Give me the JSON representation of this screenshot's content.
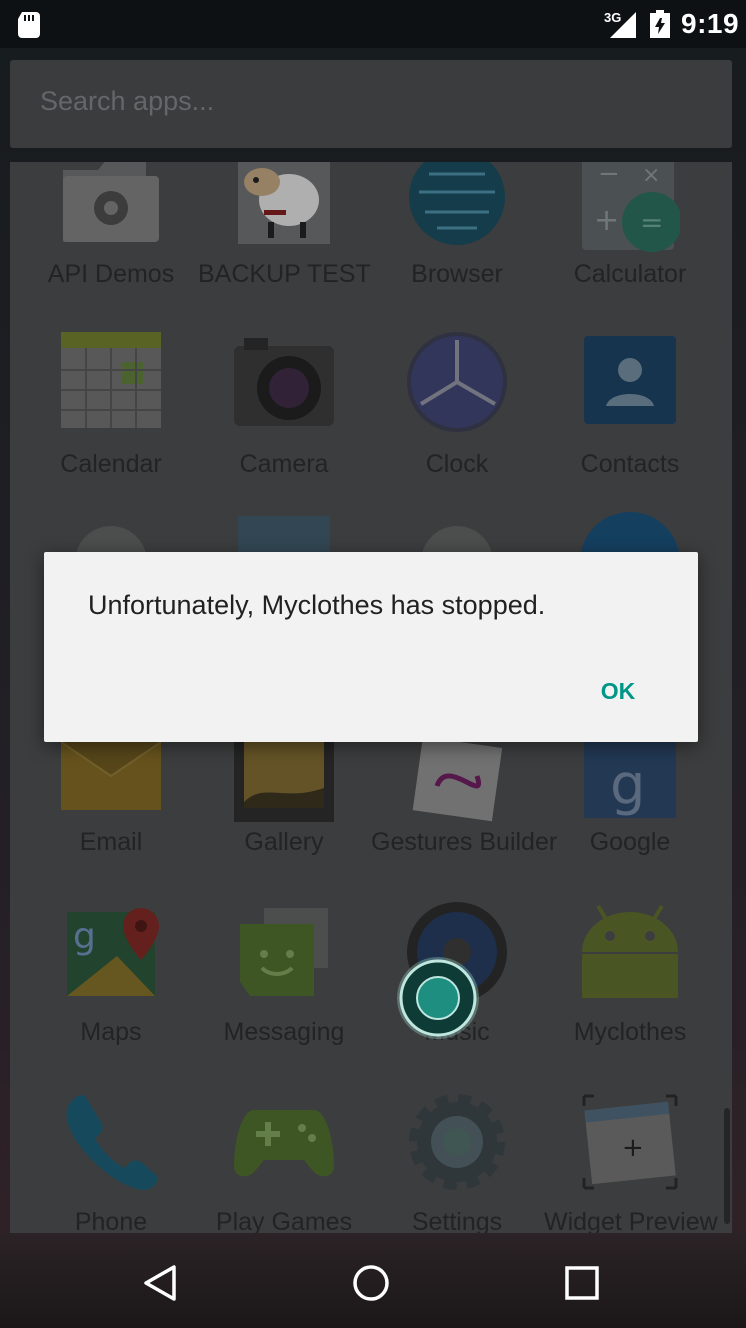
{
  "status_bar": {
    "network": "3G",
    "time": "9:19",
    "icons": [
      "sd-card-icon",
      "signal-icon",
      "battery-icon"
    ]
  },
  "search": {
    "placeholder": "Search apps..."
  },
  "apps": [
    {
      "label": "API Demos",
      "icon": "folder-gear-icon"
    },
    {
      "label": "BACKUP TEST",
      "icon": "sheep-icon"
    },
    {
      "label": "Browser",
      "icon": "globe-icon"
    },
    {
      "label": "Calculator",
      "icon": "calculator-icon"
    },
    {
      "label": "Calendar",
      "icon": "calendar-icon"
    },
    {
      "label": "Camera",
      "icon": "camera-icon"
    },
    {
      "label": "Clock",
      "icon": "clock-icon"
    },
    {
      "label": "Contacts",
      "icon": "contacts-icon"
    },
    {
      "label": "Email",
      "icon": "email-icon"
    },
    {
      "label": "Gallery",
      "icon": "gallery-icon"
    },
    {
      "label": "Gestures Builder",
      "icon": "gestures-icon"
    },
    {
      "label": "Google",
      "icon": "google-icon"
    },
    {
      "label": "Maps",
      "icon": "maps-icon"
    },
    {
      "label": "Messaging",
      "icon": "messaging-icon"
    },
    {
      "label": "Music",
      "icon": "music-icon"
    },
    {
      "label": "Myclothes",
      "icon": "android-icon"
    },
    {
      "label": "Phone",
      "icon": "phone-icon"
    },
    {
      "label": "Play Games",
      "icon": "gamepad-icon"
    },
    {
      "label": "Settings",
      "icon": "settings-gear-icon"
    },
    {
      "label": "Widget Preview",
      "icon": "widget-preview-icon"
    }
  ],
  "dialog": {
    "message": "Unfortunately, Myclothes has stopped.",
    "ok_label": "OK"
  },
  "colors": {
    "accent": "#009688",
    "dialog_bg": "#f2f2f2"
  },
  "navigation": [
    "back-icon",
    "home-icon",
    "recents-icon"
  ]
}
